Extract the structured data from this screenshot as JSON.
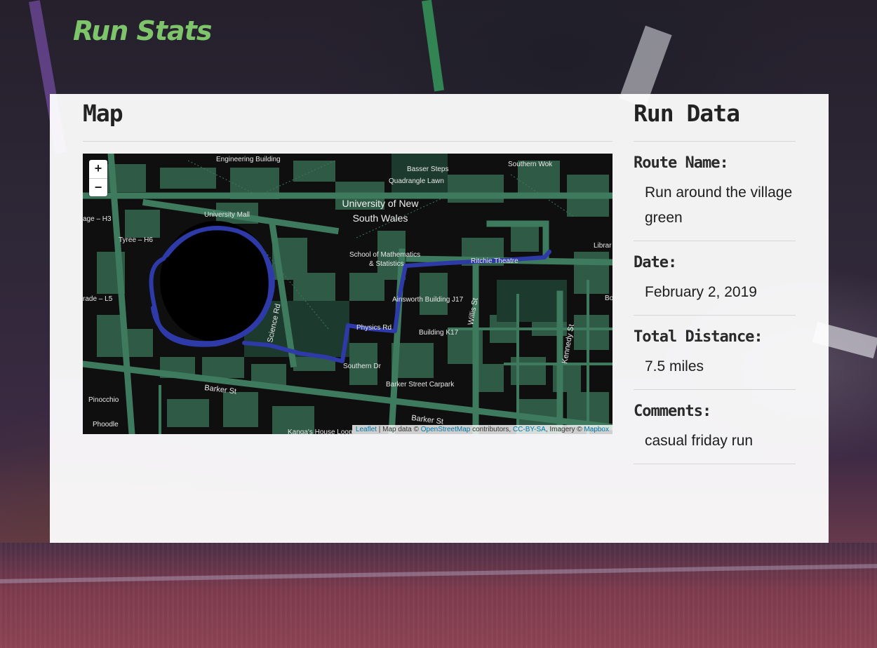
{
  "site": {
    "title": "Run Stats"
  },
  "map_section": {
    "heading": "Map",
    "zoom_in": "+",
    "zoom_out": "−",
    "attribution": {
      "leaflet": "Leaflet",
      "sep": " | Map data © ",
      "osm": "OpenStreetMap",
      "contributors": " contributors, ",
      "license": "CC-BY-SA",
      "imagery": ", Imagery © ",
      "mapbox": "Mapbox"
    },
    "labels": {
      "engineering": "Engineering Building",
      "basser": "Basser Steps",
      "southern_wok": "Southern Wok",
      "quadrangle": "Quadrangle Lawn",
      "uni_line1": "University of New",
      "uni_line2": "South Wales",
      "uni_mall": "University Mall",
      "village": "age – H3",
      "tyree": "Tyree – H6",
      "maths1": "School of Mathematics",
      "maths2": "& Statistics",
      "ritchie": "Ritchie Theatre",
      "library": "Librar",
      "grade": "rade – L5",
      "science": "Science Rd",
      "ainsworth": "Ainsworth Building J17",
      "physics": "Physics Rd",
      "building_k17": "Building K17",
      "willis": "Willis St",
      "kennedy": "Kennedy St",
      "bo": "Bo",
      "southern_dr": "Southern Dr",
      "barker_carpark": "Barker Street Carpark",
      "barker_st": "Barker St",
      "barker_st2": "Barker St",
      "pinocchio": "Pinocchio",
      "phoodle": "Phoodle",
      "kangas": "Kanga's House Loop"
    }
  },
  "run_data": {
    "heading": "Run Data",
    "route_label": "Route Name:",
    "route_value": "Run around the village green",
    "date_label": "Date:",
    "date_value": "February 2, 2019",
    "distance_label": "Total Distance:",
    "distance_value": "7.5 miles",
    "comments_label": "Comments:",
    "comments_value": "casual friday run"
  },
  "colors": {
    "title": "#7dc46a",
    "route": "#2e3aa8",
    "map_building": "#2f5a45",
    "map_road": "#3e7a5d",
    "map_bg": "#0f0f0f"
  }
}
